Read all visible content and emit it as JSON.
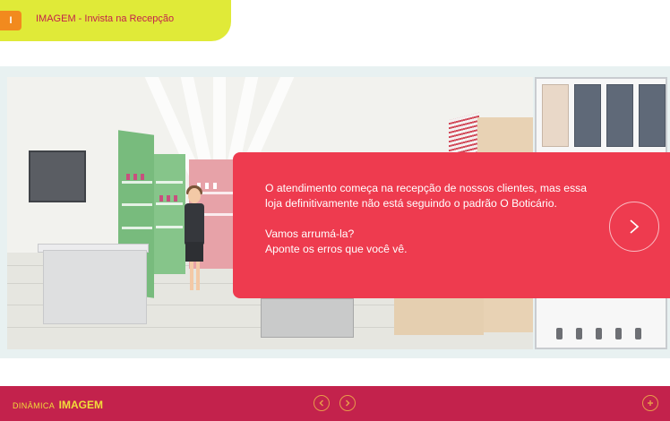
{
  "header": {
    "module_number": "I",
    "title": "IMAGEM - Invista na Recepção"
  },
  "dialog": {
    "paragraph_1": "O atendimento começa na recepção de nossos clientes, mas essa loja definitivamente não está seguindo o padrão O Boticário.",
    "paragraph_2_line_1": "Vamos arrumá-la?",
    "paragraph_2_line_2": "Aponte os erros que você vê."
  },
  "footer": {
    "brand_small": "DINÂMICA",
    "brand_big": "IMAGEM"
  },
  "colors": {
    "accent_yellow": "#e0ea38",
    "accent_orange": "#f28a1e",
    "dialog_red": "#ee3b4f",
    "footer_pink": "#c3224c",
    "footer_text": "#f1dd3a"
  },
  "icons": {
    "next": "chevron-right-icon",
    "prev": "chevron-left-icon",
    "forward": "chevron-right-icon",
    "add": "plus-icon"
  }
}
